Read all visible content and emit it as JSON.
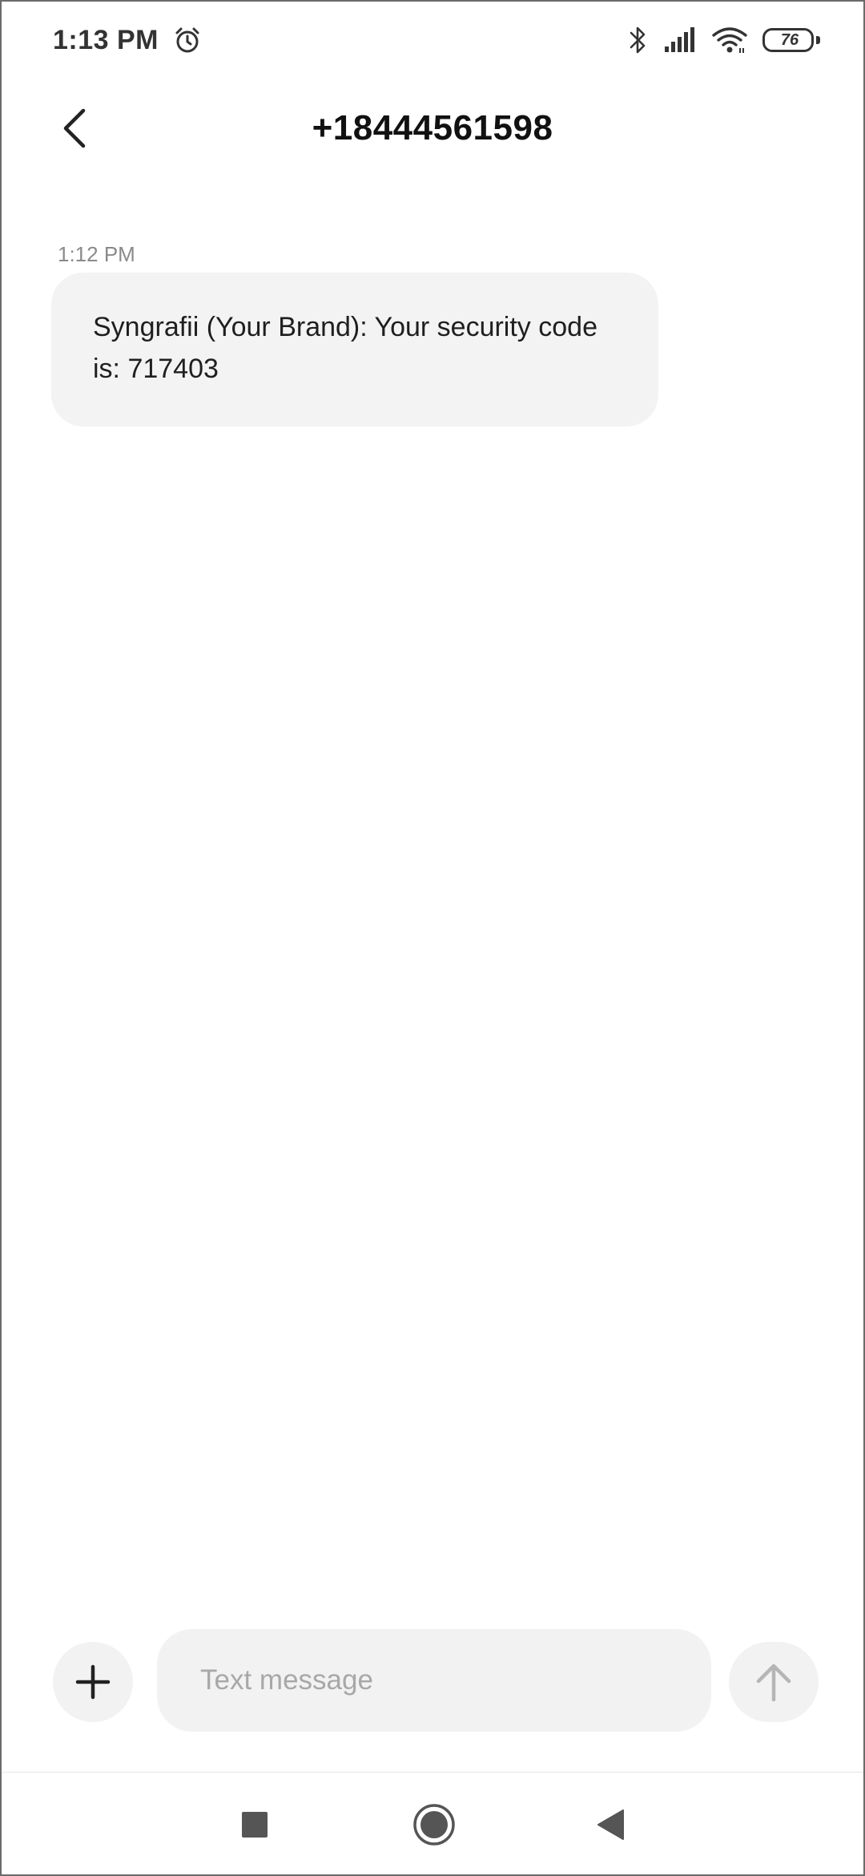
{
  "status_bar": {
    "time": "1:13 PM",
    "icons": [
      "alarm-icon",
      "bluetooth-icon",
      "signal-icon",
      "wifi-icon",
      "battery-icon"
    ],
    "battery_level": "76"
  },
  "header": {
    "title": "+18444561598",
    "back_icon": "chevron-left-icon"
  },
  "conversation": {
    "messages": [
      {
        "time": "1:12 PM",
        "text": "Syngrafii (Your Brand): Your security code is: 717403",
        "direction": "incoming"
      }
    ]
  },
  "composer": {
    "placeholder": "Text message",
    "value": "",
    "attach_icon": "plus-icon",
    "send_icon": "arrow-up-icon"
  },
  "nav_bar": {
    "icons": [
      "recents-square-icon",
      "home-circle-icon",
      "back-triangle-icon"
    ]
  },
  "colors": {
    "bubble_bg": "#f3f3f3",
    "input_bg": "#f2f2f2",
    "muted_text": "#8a8a8a",
    "placeholder": "#a8a8a8"
  }
}
